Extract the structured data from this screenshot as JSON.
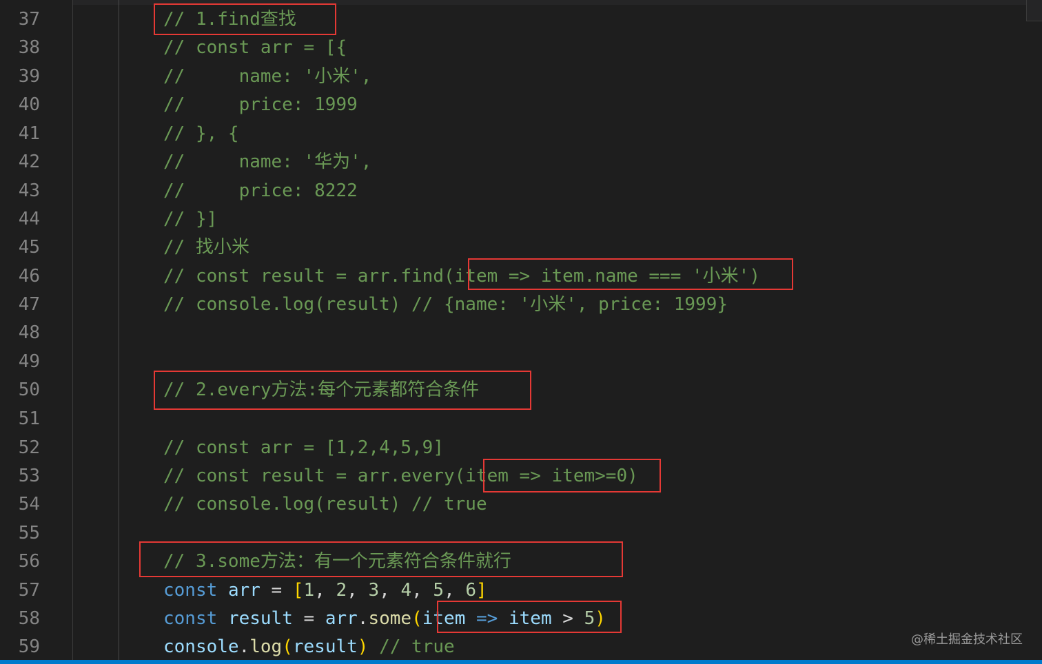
{
  "editor": {
    "line_numbers": [
      "37",
      "38",
      "39",
      "40",
      "41",
      "42",
      "43",
      "44",
      "45",
      "46",
      "47",
      "48",
      "49",
      "50",
      "51",
      "52",
      "53",
      "54",
      "55",
      "56",
      "57",
      "58",
      "59"
    ],
    "lines": {
      "l37": "// 1.find查找",
      "l38": "// const arr = [{",
      "l39": "//     name: '小米',",
      "l40": "//     price: 1999",
      "l41": "// }, {",
      "l42": "//     name: '华为',",
      "l43": "//     price: 8222",
      "l44": "// }]",
      "l45": "// 找小米",
      "l46": "// const result = arr.find(item => item.name === '小米')",
      "l47": "// console.log(result) // {name: '小米', price: 1999}",
      "l50": "// 2.every方法:每个元素都符合条件",
      "l52": "// const arr = [1,2,4,5,9]",
      "l53": "// const result = arr.every(item => item>=0)",
      "l54": "// console.log(result) // true",
      "l56": "// 3.some方法：有一个元素符合条件就行",
      "l57": {
        "kw": "const",
        "var": "arr",
        "eq": " = ",
        "open": "[",
        "n1": "1",
        "n2": "2",
        "n3": "3",
        "n4": "4",
        "n5": "5",
        "n6": "6",
        "close": "]"
      },
      "l58": {
        "kw": "const",
        "var": "result",
        "eq": " = ",
        "obj": "arr",
        "dot": ".",
        "fn": "some",
        "open": "(",
        "p": "item",
        "arrow": "=>",
        "p2": "item",
        "gt": " > ",
        "n": "5",
        "close": ")"
      },
      "l59": {
        "obj": "console",
        "dot": ".",
        "fn": "log",
        "open": "(",
        "arg": "result",
        "close": ")",
        "cm": " // true"
      }
    }
  },
  "watermark": "@稀土掘金技术社区",
  "colors": {
    "background": "#1e1e1e",
    "comment": "#6a9955",
    "keyword": "#569cd6",
    "variable": "#9cdcfe",
    "function": "#dcdcaa",
    "number": "#b5cea8",
    "highlight_box": "#e53935",
    "status_bar": "#007acc"
  }
}
